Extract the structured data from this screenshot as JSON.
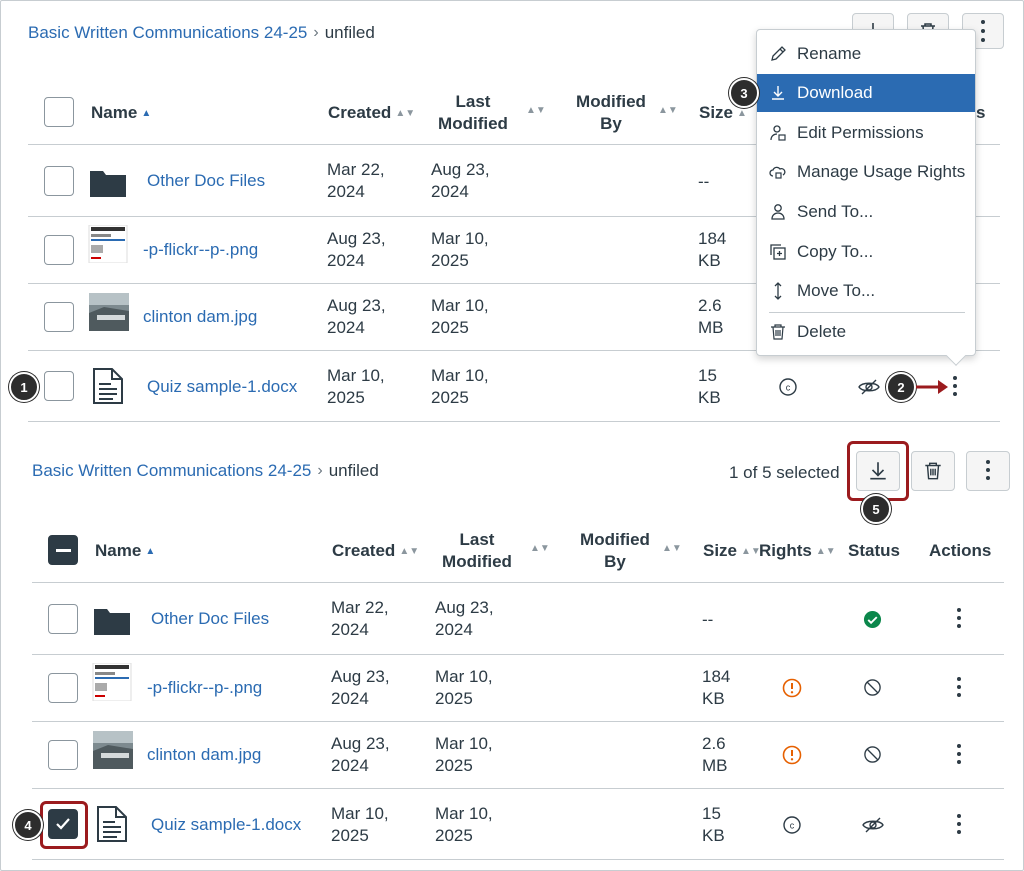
{
  "top": {
    "breadcrumb": {
      "course": "Basic Written Communications 24-25",
      "folder": "unfiled"
    },
    "columns": {
      "name": "Name",
      "created": "Created",
      "last_modified": "Last\nModified",
      "modified_by": "Modified\nBy",
      "size": "Size",
      "actions": "s"
    },
    "rows": [
      {
        "name": "Other Doc Files",
        "created": "Mar 22,\n2024",
        "modified": "Aug 23,\n2024",
        "size": "--"
      },
      {
        "name": "-p-flickr--p-.png",
        "created": "Aug 23,\n2024",
        "modified": "Mar 10,\n2025",
        "size": "184\nKB"
      },
      {
        "name": "clinton dam.jpg",
        "created": "Aug 23,\n2024",
        "modified": "Mar 10,\n2025",
        "size": "2.6\nMB"
      },
      {
        "name": "Quiz sample-1.docx",
        "created": "Mar 10,\n2025",
        "modified": "Mar 10,\n2025",
        "size": "15\nKB"
      }
    ],
    "menu": {
      "items": [
        {
          "label": "Rename",
          "icon": "pencil-icon"
        },
        {
          "label": "Download",
          "icon": "download-icon"
        },
        {
          "label": "Edit Permissions",
          "icon": "user-lock-icon"
        },
        {
          "label": "Manage Usage Rights",
          "icon": "cloud-lock-icon"
        },
        {
          "label": "Send To...",
          "icon": "user-icon"
        },
        {
          "label": "Copy To...",
          "icon": "copy-icon"
        },
        {
          "label": "Move To...",
          "icon": "move-icon"
        },
        {
          "label": "Delete",
          "icon": "trash-icon"
        }
      ]
    }
  },
  "bottom": {
    "breadcrumb": {
      "course": "Basic Written Communications 24-25",
      "folder": "unfiled"
    },
    "selection": "1 of 5 selected",
    "columns": {
      "name": "Name",
      "created": "Created",
      "last_modified": "Last\nModified",
      "modified_by": "Modified\nBy",
      "size": "Size",
      "rights": "Rights",
      "status": "Status",
      "actions": "Actions"
    },
    "rows": [
      {
        "name": "Other Doc Files",
        "created": "Mar 22,\n2024",
        "modified": "Aug 23,\n2024",
        "size": "--",
        "status": "published"
      },
      {
        "name": "-p-flickr--p-.png",
        "created": "Aug 23,\n2024",
        "modified": "Mar 10,\n2025",
        "size": "184\nKB",
        "rights": "warning",
        "status": "unpublished"
      },
      {
        "name": "clinton dam.jpg",
        "created": "Aug 23,\n2024",
        "modified": "Mar 10,\n2025",
        "size": "2.6\nMB",
        "rights": "warning",
        "status": "unpublished"
      },
      {
        "name": "Quiz sample-1.docx",
        "created": "Mar 10,\n2025",
        "modified": "Mar 10,\n2025",
        "size": "15\nKB",
        "rights": "copyright",
        "status": "hidden"
      }
    ]
  },
  "callouts": [
    "1",
    "2",
    "3",
    "4",
    "5"
  ],
  "colors": {
    "link": "#2b6bb2",
    "menu_active": "#2b6bb2",
    "highlight": "#9b1b1e",
    "success": "#0b874b",
    "warning": "#e66000"
  }
}
